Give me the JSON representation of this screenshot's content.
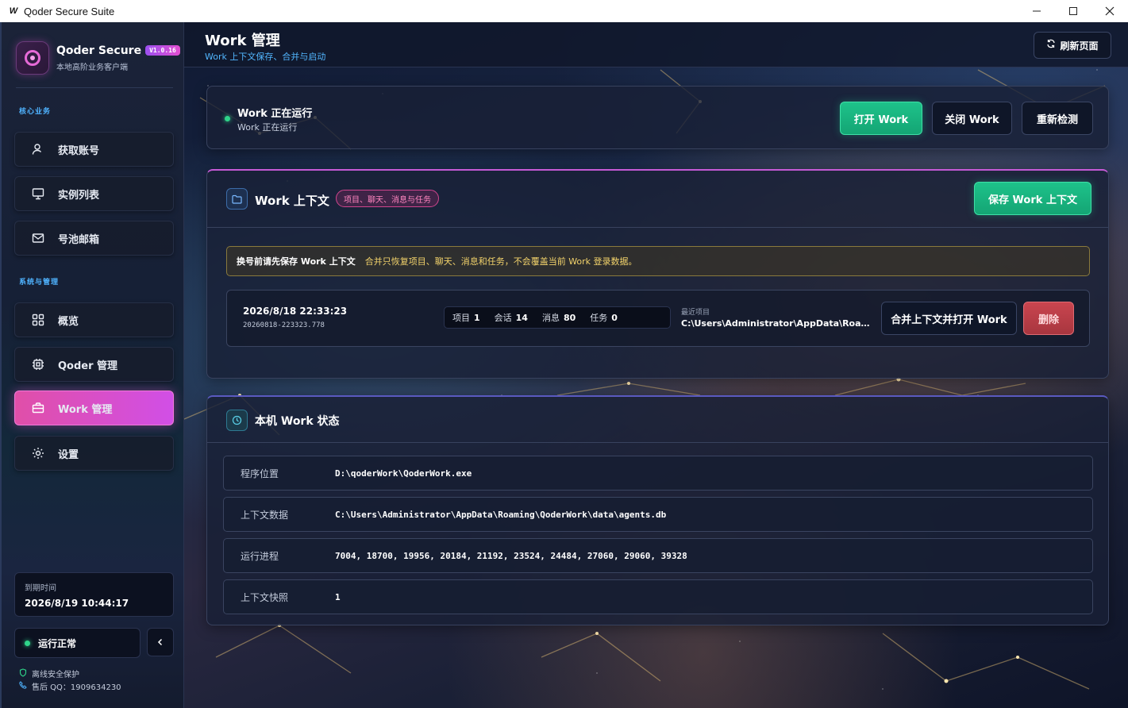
{
  "window": {
    "title": "Qoder Secure Suite",
    "icon_glyph": "W",
    "controls": [
      "minimize-icon",
      "maximize-icon",
      "close-icon"
    ]
  },
  "sidebar": {
    "brand": {
      "name": "Qoder Secure",
      "version": "V1.0.16",
      "subtitle": "本地高阶业务客户端"
    },
    "section_core": "核心业务",
    "section_system": "系统与管理",
    "items": [
      {
        "label": "获取账号",
        "icon": "user-icon"
      },
      {
        "label": "实例列表",
        "icon": "monitor-icon"
      },
      {
        "label": "号池邮箱",
        "icon": "mail-icon"
      },
      {
        "label": "概览",
        "icon": "grid-icon"
      },
      {
        "label": "Qoder 管理",
        "icon": "chip-icon"
      },
      {
        "label": "Work 管理",
        "icon": "briefcase-icon",
        "active": true
      },
      {
        "label": "设置",
        "icon": "gear-icon"
      }
    ],
    "expiry": {
      "label": "到期时间",
      "value": "2026/8/19 10:44:17"
    },
    "status": "运行正常",
    "footer": {
      "protection": "离线安全保护",
      "support": "售后 QQ：1909634230"
    }
  },
  "header": {
    "title": "Work 管理",
    "subtitle": "Work 上下文保存、合并与启动",
    "refresh_label": "刷新页面"
  },
  "run_status": {
    "title": "Work 正在运行",
    "subtitle": "Work 正在运行",
    "open_label": "打开 Work",
    "close_label": "关闭 Work",
    "recheck_label": "重新检测"
  },
  "context": {
    "title": "Work 上下文",
    "badge": "项目、聊天、消息与任务",
    "save_label": "保存 Work 上下文",
    "warning_strong": "换号前请先保存 Work 上下文",
    "warning_text": "合并只恢复项目、聊天、消息和任务，不会覆盖当前 Work 登录数据。",
    "snapshots": [
      {
        "date": "2026/8/18 22:33:23",
        "id": "20260818-223323.778",
        "stats": [
          {
            "label": "项目",
            "value": "1"
          },
          {
            "label": "会话",
            "value": "14"
          },
          {
            "label": "消息",
            "value": "80"
          },
          {
            "label": "任务",
            "value": "0"
          }
        ],
        "recent_label": "最近项目",
        "recent_value": "C:\\Users\\Administrator\\AppData\\Roamin...",
        "merge_label": "合并上下文并打开 Work",
        "delete_label": "删除"
      }
    ]
  },
  "local_status": {
    "title": "本机 Work 状态",
    "rows": [
      {
        "key": "程序位置",
        "value": "D:\\qoderWork\\QoderWork.exe"
      },
      {
        "key": "上下文数据",
        "value": "C:\\Users\\Administrator\\AppData\\Roaming\\QoderWork\\data\\agents.db"
      },
      {
        "key": "运行进程",
        "value": "7004, 18700, 19956, 20184, 21192, 23524, 24484, 27060, 29060, 39328"
      },
      {
        "key": "上下文快照",
        "value": "1"
      }
    ]
  },
  "colors": {
    "accent_pink": "#d14fe6",
    "success_green": "#1ec28a",
    "danger_red": "#c9454f",
    "info_blue": "#52b6ff",
    "warning_yellow": "#f3d36b"
  }
}
